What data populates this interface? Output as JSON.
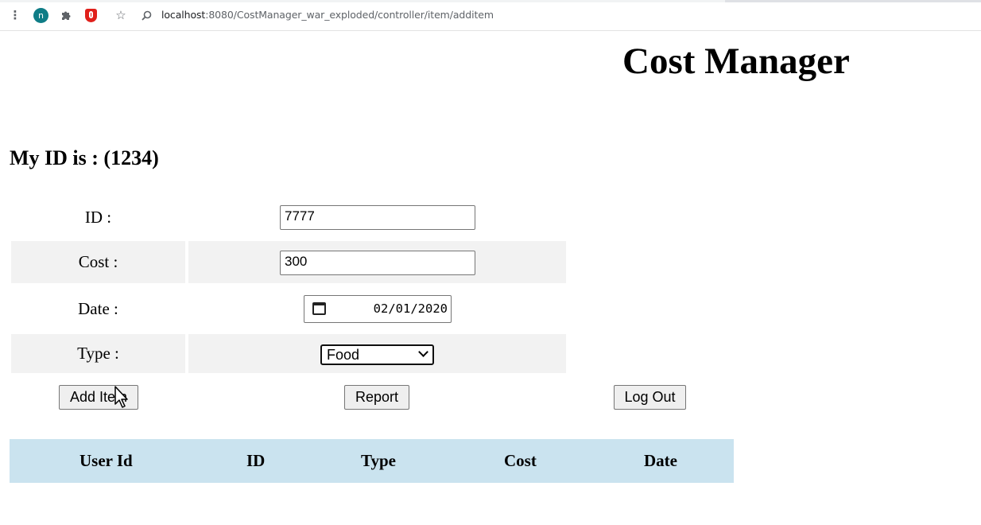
{
  "browser": {
    "url_host": "localhost",
    "url_rest": ":8080/CostManager_war_exploded/controller/item/additem",
    "icons": [
      "menu-icon",
      "extension-n-icon",
      "puzzle-icon",
      "shield-icon",
      "star-icon",
      "zoom-icon"
    ],
    "ext_letter": "n"
  },
  "page": {
    "title": "Cost Manager",
    "my_id": "My ID is : (1234)"
  },
  "form": {
    "id_label": "ID :",
    "id_value": "7777",
    "cost_label": "Cost :",
    "cost_value": "300",
    "date_label": "Date :",
    "date_value": "02/01/2020",
    "type_label": "Type :",
    "type_value": "Food"
  },
  "buttons": {
    "add_item": "Add Item",
    "report": "Report",
    "logout": "Log Out"
  },
  "table": {
    "columns": [
      "User Id",
      "ID",
      "Type",
      "Cost",
      "Date"
    ],
    "header_color": "#cae3ef"
  }
}
